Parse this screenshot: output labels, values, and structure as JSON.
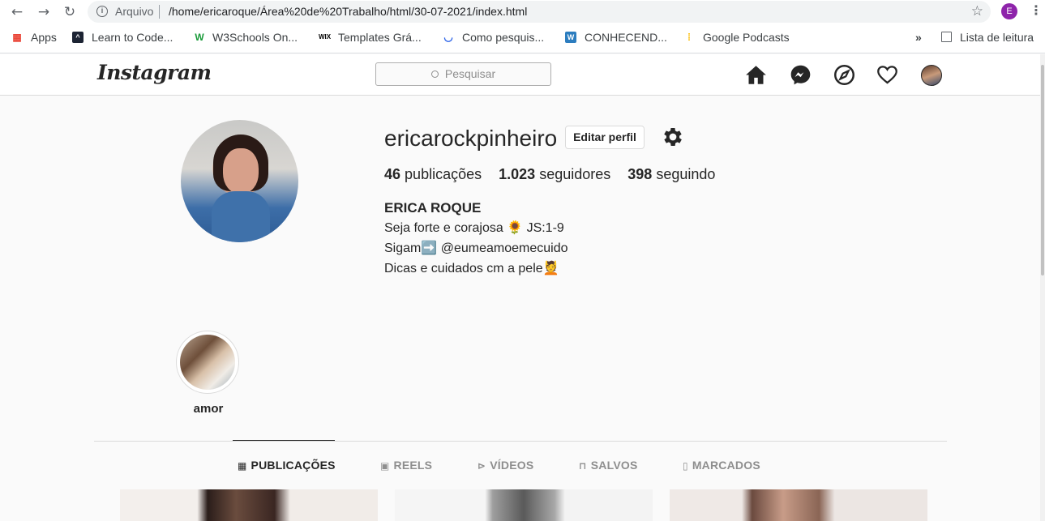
{
  "browser": {
    "scheme_label": "Arquivo",
    "url": "/home/ericaroque/Área%20de%20Trabalho/html/30-07-2021/index.html",
    "profile_initial": "E",
    "bookmarks": [
      {
        "label": "Apps"
      },
      {
        "label": "Learn to Code..."
      },
      {
        "label": "W3Schools On..."
      },
      {
        "label": "Templates Grá..."
      },
      {
        "label": "Como pesquis..."
      },
      {
        "label": "CONHECEND..."
      },
      {
        "label": "Google Podcasts"
      }
    ],
    "overflow": "»",
    "reading_list": "Lista de leitura"
  },
  "header": {
    "logo": "Instagram",
    "search_placeholder": "Pesquisar",
    "nav_icons": [
      "home-icon",
      "messenger-icon",
      "explore-icon",
      "heart-icon",
      "profile-avatar"
    ]
  },
  "profile": {
    "username": "ericarockpinheiro",
    "edit_label": "Editar perfil",
    "stats": {
      "posts_count": "46",
      "posts_label": "publicações",
      "followers_count": "1.023",
      "followers_label": "seguidores",
      "following_count": "398",
      "following_label": "seguindo"
    },
    "full_name": "ERICA ROQUE",
    "bio": [
      "Seja forte e corajosa 🌻 JS:1-9",
      "Sigam➡️ @eumeamoemecuido",
      "Dicas e cuidados cm a pele💆"
    ]
  },
  "highlights": [
    {
      "label": "amor"
    }
  ],
  "tabs": [
    {
      "label": "PUBLICAÇÕES",
      "icon": "grid-icon",
      "active": true
    },
    {
      "label": "REELS",
      "icon": "reels-icon",
      "active": false
    },
    {
      "label": "VÍDEOS",
      "icon": "video-icon",
      "active": false
    },
    {
      "label": "SALVOS",
      "icon": "bookmark-icon",
      "active": false
    },
    {
      "label": "MARCADOS",
      "icon": "tag-icon",
      "active": false
    }
  ],
  "colors": {
    "text": "#262626",
    "muted": "#8e8e8e",
    "border": "#dbdbdb",
    "background": "#fafafa"
  }
}
